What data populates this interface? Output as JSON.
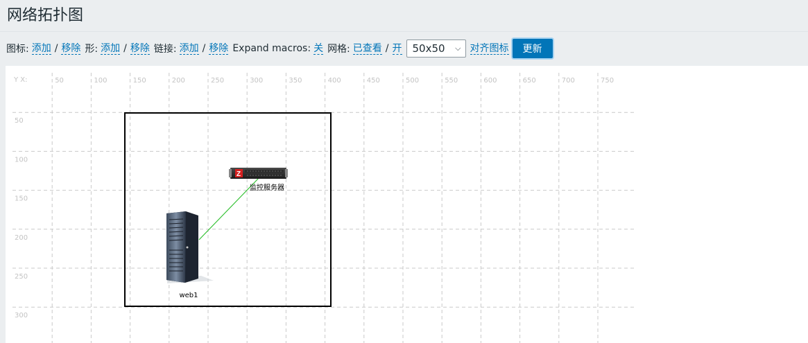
{
  "page": {
    "title": "网络拓扑图"
  },
  "toolbar": {
    "icon_label": "图标:",
    "icon_add": "添加",
    "icon_remove": "移除",
    "shape_label": "形:",
    "shape_add": "添加",
    "shape_remove": "移除",
    "link_label": "链接:",
    "link_add": "添加",
    "link_remove": "移除",
    "expand_label": "Expand macros:",
    "expand_value": "关",
    "grid_label": "网格:",
    "grid_shown": "已查看",
    "grid_on": "开",
    "separator": "/",
    "grid_size": "50x50",
    "align_icons": "对齐图标",
    "update": "更新"
  },
  "map": {
    "axis_corner": "Y X:",
    "x_ticks": [
      "50",
      "100",
      "150",
      "200",
      "250",
      "300",
      "350",
      "400",
      "450",
      "500",
      "550",
      "600",
      "650",
      "700",
      "750"
    ],
    "y_ticks": [
      "50",
      "100",
      "150",
      "200",
      "250",
      "300"
    ],
    "nodes": [
      {
        "label": "监控服务器",
        "icon": "rack-server-icon"
      },
      {
        "label": "web1",
        "icon": "tower-server-icon"
      }
    ],
    "link_color": "#31c131",
    "grid_color": "#c9c9c9",
    "tick_color": "#c3c3c3"
  }
}
